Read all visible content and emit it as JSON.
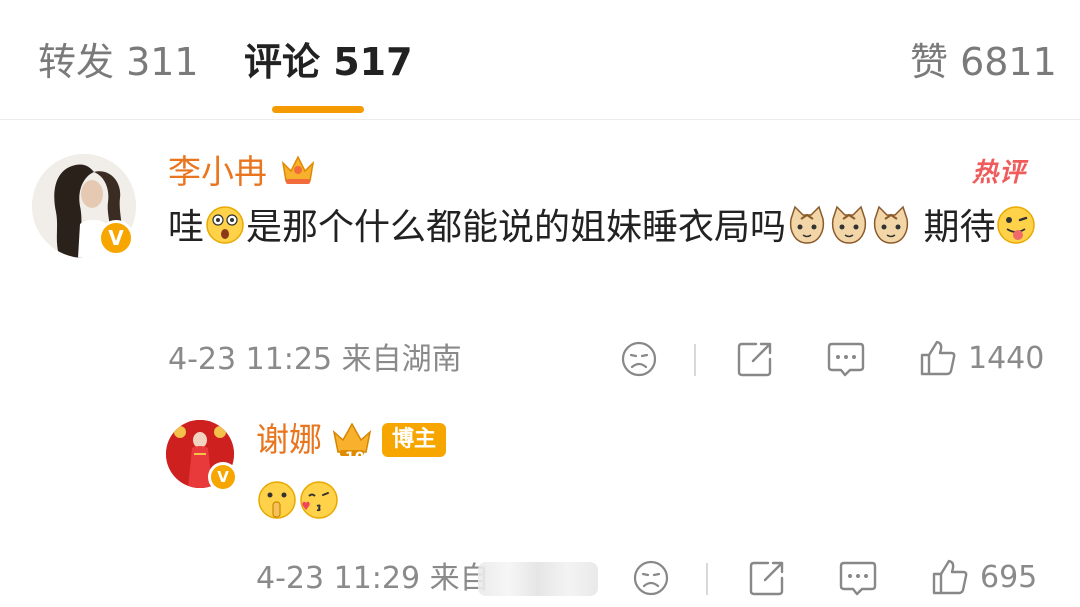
{
  "tabs": [
    {
      "label": "转发 311",
      "active": false
    },
    {
      "label": "评论 517",
      "active": true
    },
    {
      "label": "赞 6811",
      "active": false
    }
  ],
  "accent_color": "#f59a00",
  "username_color": "#e9751f",
  "comment": {
    "username": "李小冉",
    "hot_label": "热评",
    "text_before_emoji": "哇",
    "text_middle": "是那个什么都能说的姐妹睡衣局吗",
    "text_after_cats": " 期待",
    "meta": "4-23 11:25  来自湖南",
    "like_count": "1440"
  },
  "reply": {
    "username": "谢娜",
    "level_badge": "10",
    "blogger_tag": "博主",
    "meta": "4-23 11:29  来自",
    "like_count": "695"
  },
  "icons": [
    "dislike-icon",
    "share-icon",
    "comment-icon",
    "like-icon",
    "crown-icon",
    "v-badge-icon"
  ]
}
